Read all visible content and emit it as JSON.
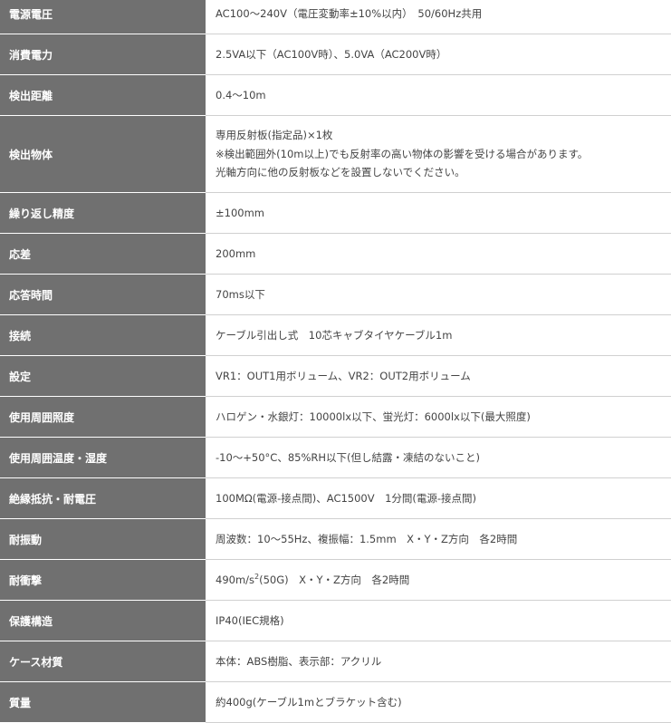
{
  "rows": [
    {
      "label": "電源電圧",
      "lines": [
        "AC100〜240V（電圧変動率±10%以内）　50/60Hz共用"
      ]
    },
    {
      "label": "消費電力",
      "lines": [
        "2.5VA以下（AC100V時）、5.0VA（AC200V時）"
      ]
    },
    {
      "label": "検出距離",
      "lines": [
        "0.4〜10m"
      ]
    },
    {
      "label": "検出物体",
      "lines": [
        "専用反射板(指定品)×1枚",
        "※検出範囲外(10m以上)でも反射率の高い物体の影響を受ける場合があります。",
        "光軸方向に他の反射板などを設置しないでください。"
      ]
    },
    {
      "label": "繰り返し精度",
      "lines": [
        "±100mm"
      ]
    },
    {
      "label": "応差",
      "lines": [
        "200mm"
      ]
    },
    {
      "label": "応答時間",
      "lines": [
        "70ms以下"
      ]
    },
    {
      "label": "接続",
      "lines": [
        "ケーブル引出し式　10芯キャブタイヤケーブル1m"
      ]
    },
    {
      "label": "設定",
      "lines": [
        "VR1：OUT1用ボリューム、VR2：OUT2用ボリューム"
      ]
    },
    {
      "label": "使用周囲照度",
      "lines": [
        "ハロゲン・水銀灯：10000lx以下、蛍光灯：6000lx以下(最大照度)"
      ]
    },
    {
      "label": "使用周囲温度・湿度",
      "lines": [
        "-10〜+50°C、85%RH以下(但し結露・凍結のないこと)"
      ]
    },
    {
      "label": "絶縁抵抗・耐電圧",
      "lines": [
        "100MΩ(電源-接点間)、AC1500V　1分間(電源-接点間)"
      ]
    },
    {
      "label": "耐振動",
      "lines": [
        "周波数：10〜55Hz、複振幅：1.5mm　X・Y・Z方向　各2時間"
      ]
    },
    {
      "label": "耐衝撃",
      "pre": "490m/s",
      "sup": "2",
      "post": "(50G)　X・Y・Z方向　各2時間"
    },
    {
      "label": "保護構造",
      "lines": [
        "IP40(IEC規格)"
      ]
    },
    {
      "label": "ケース材質",
      "lines": [
        "本体：ABS樹脂、表示部：アクリル"
      ]
    },
    {
      "label": "質量",
      "lines": [
        "約400g(ケーブル1mとブラケット含む)"
      ]
    }
  ]
}
